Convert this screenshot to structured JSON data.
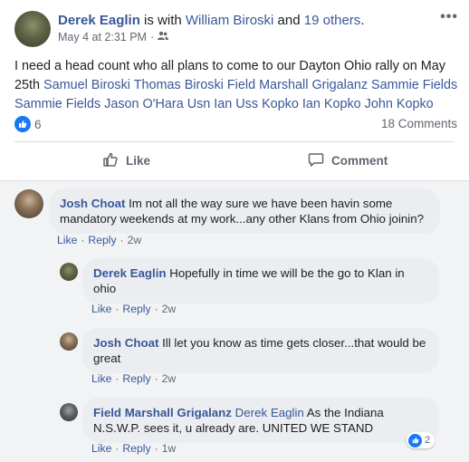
{
  "post": {
    "author": "Derek Eaglin",
    "with_text": " is with ",
    "tagged": "William Biroski",
    "and_text": " and ",
    "others": "19 others",
    "period": ".",
    "date": "May 4 at 2:31 PM",
    "dot": "·",
    "privacy_icon": "friends-icon",
    "text_plain": "I need a head count who all plans to come to our Dayton Ohio rally on May 25th ",
    "text_tags": "Samuel Biroski Thomas Biroski Field Marshall Grigalanz Sammie Fields Sammie Fields Jason O'Hara Usn Ian Uss Kopko Ian Kopko John Kopko",
    "reaction_count": "6",
    "comments_count": "18 Comments",
    "like_label": "Like",
    "comment_label": "Comment"
  },
  "comments": [
    {
      "author": "Josh Choat",
      "text": " Im not all the way sure we have been havin some mandatory weekends at my work...any other Klans from Ohio joinin?",
      "like": "Like",
      "reply": "Reply",
      "dot": "·",
      "time": "2w"
    },
    {
      "author": "Derek Eaglin",
      "text": " Hopefully in time we will be the go to Klan in ohio",
      "like": "Like",
      "reply": "Reply",
      "dot": "·",
      "time": "2w"
    },
    {
      "author": "Josh Choat",
      "text": " Ill let you know as time gets closer...that would be great",
      "like": "Like",
      "reply": "Reply",
      "dot": "·",
      "time": "2w"
    },
    {
      "author": "Field Marshall Grigalanz",
      "mention": " Derek Eaglin",
      "text": " As the Indiana N.S.W.P. sees it, u already are. UNITED WE STAND",
      "like": "Like",
      "reply": "Reply",
      "dot": "·",
      "time": "1w",
      "reaction_count": "2"
    }
  ],
  "colors": {
    "link": "#385898",
    "like_blue": "#1877f2",
    "bubble": "#ebedf0",
    "comments_bg": "#f2f3f5"
  }
}
